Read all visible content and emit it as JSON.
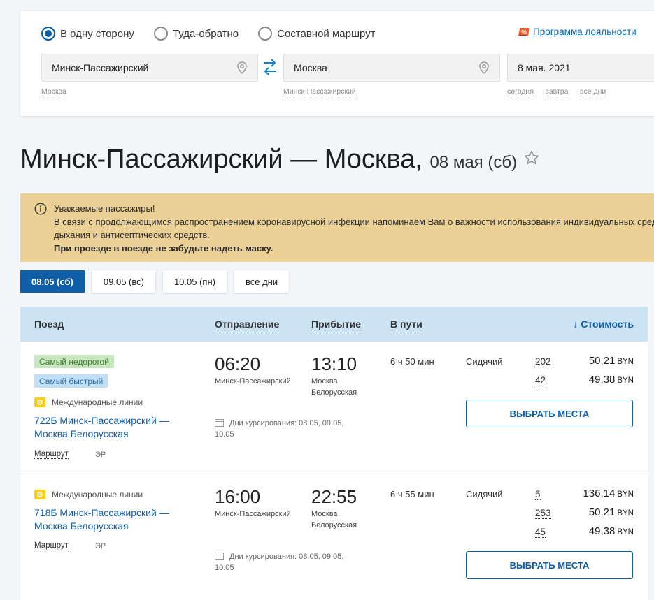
{
  "search": {
    "trip_types": [
      {
        "label": "В одну сторону",
        "selected": true
      },
      {
        "label": "Туда-обратно",
        "selected": false
      },
      {
        "label": "Составной маршрут",
        "selected": false
      }
    ],
    "loyalty_badge": "%",
    "loyalty_label": "Программа лояльности",
    "from_value": "Минск-Пассажирский",
    "to_value": "Москва",
    "date_value": "8 мая. 2021",
    "from_hint": "Москва",
    "to_hint": "Минск-Пассажирский",
    "date_hints": [
      "сегодня",
      "завтра",
      "все дни"
    ]
  },
  "heading": {
    "route": "Минск-Пассажирский — Москва,",
    "date": "08 мая (сб)"
  },
  "notice": {
    "line1": "Уважаемые пассажиры!",
    "line2": "В связи с продолжающимся распространением коронавирусной инфекции напоминаем Вам о важности использования индивидуальных средств защиты органов",
    "line3": "дыхания и антисептических средств.",
    "line4": "При проезде в поезде не забудьте надеть маску."
  },
  "date_tabs": [
    "08.05 (сб)",
    "09.05 (вс)",
    "10.05 (пн)",
    "все дни"
  ],
  "table_head": {
    "train": "Поезд",
    "departure": "Отправление",
    "arrival": "Прибытие",
    "duration": "В пути",
    "price": "↓ Стоимость"
  },
  "trains": [
    {
      "badges": [
        "Самый недорогой",
        "Самый быстрый"
      ],
      "intl": "Международные линии",
      "name1": "722Б Минск-Пассажирский —",
      "name2": "Москва Белорусская",
      "route": "Маршрут",
      "er": "ЭР",
      "dep_time": "06:20",
      "dep_station": "Минск-Пассажирский",
      "arr_time": "13:10",
      "arr_station1": "Москва",
      "arr_station2": "Белорусская",
      "days1": "Дни курсирования: 08.05, 09.05,",
      "days2": "10.05",
      "duration": "6 ч 50 мин",
      "class": "Сидячий",
      "fares": [
        {
          "seats": "202",
          "price": "50,21",
          "cur": "BYN"
        },
        {
          "seats": "42",
          "price": "49,38",
          "cur": "BYN"
        }
      ],
      "button": "ВЫБРАТЬ МЕСТА"
    },
    {
      "intl": "Международные линии",
      "name1": "718Б Минск-Пассажирский —",
      "name2": "Москва Белорусская",
      "route": "Маршрут",
      "er": "ЭР",
      "dep_time": "16:00",
      "dep_station": "Минск-Пассажирский",
      "arr_time": "22:55",
      "arr_station1": "Москва",
      "arr_station2": "Белорусская",
      "days1": "Дни курсирования: 08.05, 09.05,",
      "days2": "10.05",
      "duration": "6 ч 55 мин",
      "class": "Сидячий",
      "fares": [
        {
          "seats": "5",
          "price": "136,14",
          "cur": "BYN"
        },
        {
          "seats": "253",
          "price": "50,21",
          "cur": "BYN"
        },
        {
          "seats": "45",
          "price": "49,38",
          "cur": "BYN"
        }
      ],
      "button": "ВЫБРАТЬ МЕСТА"
    }
  ],
  "colors": {
    "accent": "#0f5ea7",
    "notice_bg": "#ecd197",
    "header_bg": "#cbe3f3"
  }
}
